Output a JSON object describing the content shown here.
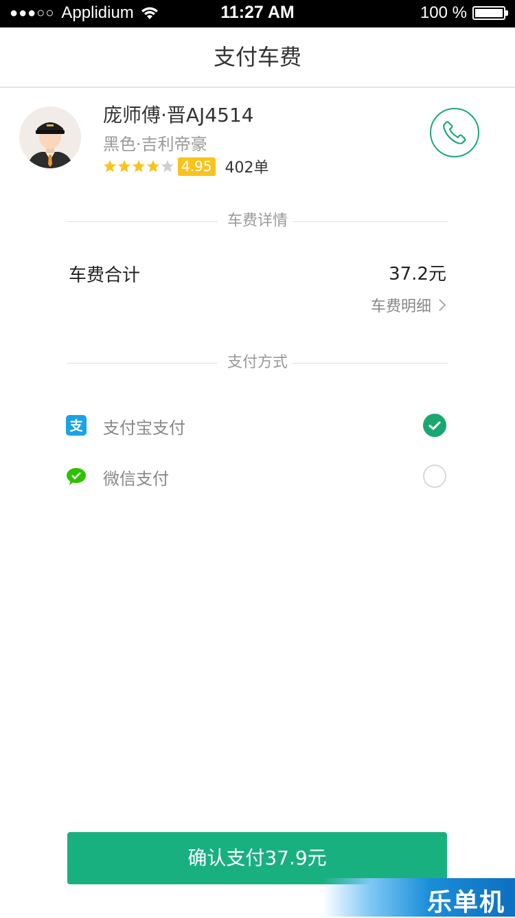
{
  "status_bar": {
    "signal": "●●●○○",
    "carrier": "Applidium",
    "time": "11:27 AM",
    "battery": "100 %"
  },
  "nav": {
    "title": "支付车费"
  },
  "driver": {
    "name": "庞师傅·晋AJ4514",
    "car": "黑色·吉利帝豪",
    "rating_stars": 4,
    "rating_total": 5,
    "rating": "4.95",
    "orders": "402单"
  },
  "fare_section": {
    "title": "车费详情",
    "total_label": "车费合计",
    "total_value": "37.2元",
    "detail_link": "车费明细"
  },
  "payment_section": {
    "title": "支付方式",
    "methods": [
      {
        "label": "支付宝支付",
        "icon": "alipay-icon",
        "selected": true
      },
      {
        "label": "微信支付",
        "icon": "wechat-icon",
        "selected": false
      }
    ]
  },
  "confirm": {
    "label": "确认支付37.9元"
  },
  "watermark": {
    "text": "乐单机"
  },
  "colors": {
    "accent": "#19b07f",
    "rating_badge": "#f9c31c",
    "alipay": "#1aa2e6",
    "wechat": "#2dc100"
  }
}
